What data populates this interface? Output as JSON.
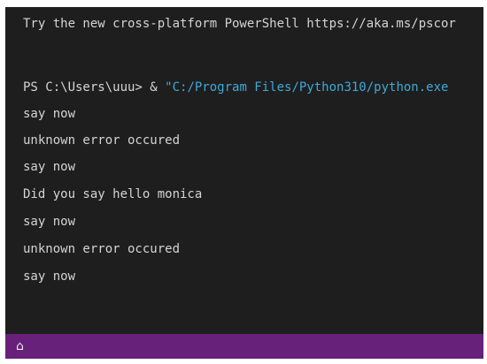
{
  "terminal": {
    "banner": "Try the new cross-platform PowerShell https://aka.ms/pscor",
    "prompt": {
      "text": "PS C:\\Users\\uuu> & ",
      "path": "\"C:/Program Files/Python310/python.exe"
    },
    "output_lines": [
      "say now",
      "unknown error occured",
      "say now",
      "Did you say hello monica",
      "say now",
      "unknown error occured",
      "say now"
    ],
    "colors": {
      "background": "#1e1e1e",
      "text": "#d4d4d4",
      "string": "#3fa9d8"
    }
  },
  "statusbar": {
    "left_item": "⌂",
    "color": "#68217a"
  }
}
